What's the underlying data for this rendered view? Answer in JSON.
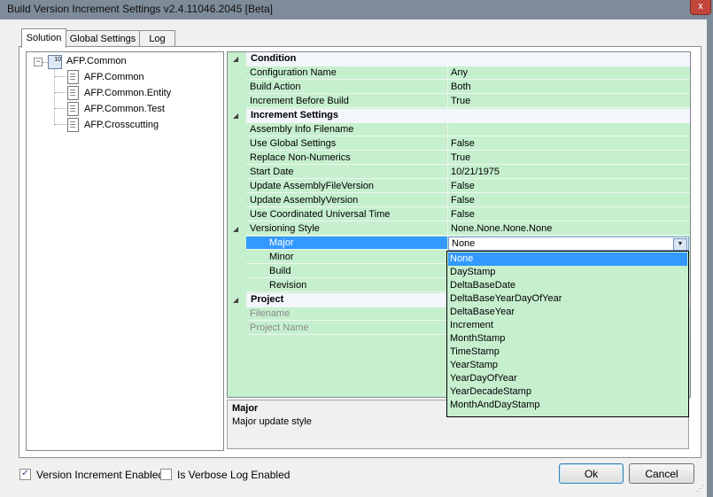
{
  "window": {
    "title": "Build Version Increment Settings v2.4.11046.2045 [Beta]",
    "close_label": "x"
  },
  "tabs": [
    {
      "label": "Solution"
    },
    {
      "label": "Global Settings"
    },
    {
      "label": "Log"
    }
  ],
  "tree": {
    "root": {
      "label": "AFP.Common",
      "expander": "−",
      "icon_badge": "10"
    },
    "children": [
      {
        "label": "AFP.Common"
      },
      {
        "label": "AFP.Common.Entity"
      },
      {
        "label": "AFP.Common.Test"
      },
      {
        "label": "AFP.Crosscutting"
      }
    ]
  },
  "property_grid": {
    "toggle_glyph": "◢",
    "categories": {
      "condition": "Condition",
      "increment": "Increment Settings",
      "project": "Project"
    },
    "rows": {
      "configuration_name": {
        "name": "Configuration Name",
        "value": "Any"
      },
      "build_action": {
        "name": "Build Action",
        "value": "Both"
      },
      "increment_before_build": {
        "name": "Increment Before Build",
        "value": "True"
      },
      "assembly_info_filename": {
        "name": "Assembly Info Filename",
        "value": ""
      },
      "use_global_settings": {
        "name": "Use Global Settings",
        "value": "False"
      },
      "replace_non_numerics": {
        "name": "Replace Non-Numerics",
        "value": "True"
      },
      "start_date": {
        "name": "Start Date",
        "value": "10/21/1975"
      },
      "update_assembly_file_version": {
        "name": "Update AssemblyFileVersion",
        "value": "False"
      },
      "update_assembly_version": {
        "name": "Update AssemblyVersion",
        "value": "False"
      },
      "use_utc": {
        "name": "Use Coordinated Universal Time",
        "value": "False"
      },
      "versioning_style": {
        "name": "Versioning Style",
        "value": "None.None.None.None"
      },
      "major": {
        "name": "Major",
        "value": "None"
      },
      "minor": {
        "name": "Minor",
        "value": ""
      },
      "build": {
        "name": "Build",
        "value": ""
      },
      "revision": {
        "name": "Revision",
        "value": ""
      },
      "filename": {
        "name": "Filename",
        "value": ""
      },
      "project_name": {
        "name": "Project Name",
        "value": ""
      }
    },
    "dropdown_arrow": "▼",
    "dropdown_options": [
      "None",
      "DayStamp",
      "DeltaBaseDate",
      "DeltaBaseYearDayOfYear",
      "DeltaBaseYear",
      "Increment",
      "MonthStamp",
      "TimeStamp",
      "YearStamp",
      "YearDayOfYear",
      "YearDecadeStamp",
      "MonthAndDayStamp"
    ]
  },
  "help": {
    "title": "Major",
    "description": "Major update style"
  },
  "footer": {
    "version_increment": {
      "label": "Version Increment Enabled",
      "check": "✓"
    },
    "verbose_log": {
      "label": "Is Verbose Log Enabled",
      "check": ""
    },
    "ok_label": "Ok",
    "cancel_label": "Cancel"
  },
  "colors": {
    "grid_bg": "#c6efce",
    "selection": "#3399ff"
  }
}
